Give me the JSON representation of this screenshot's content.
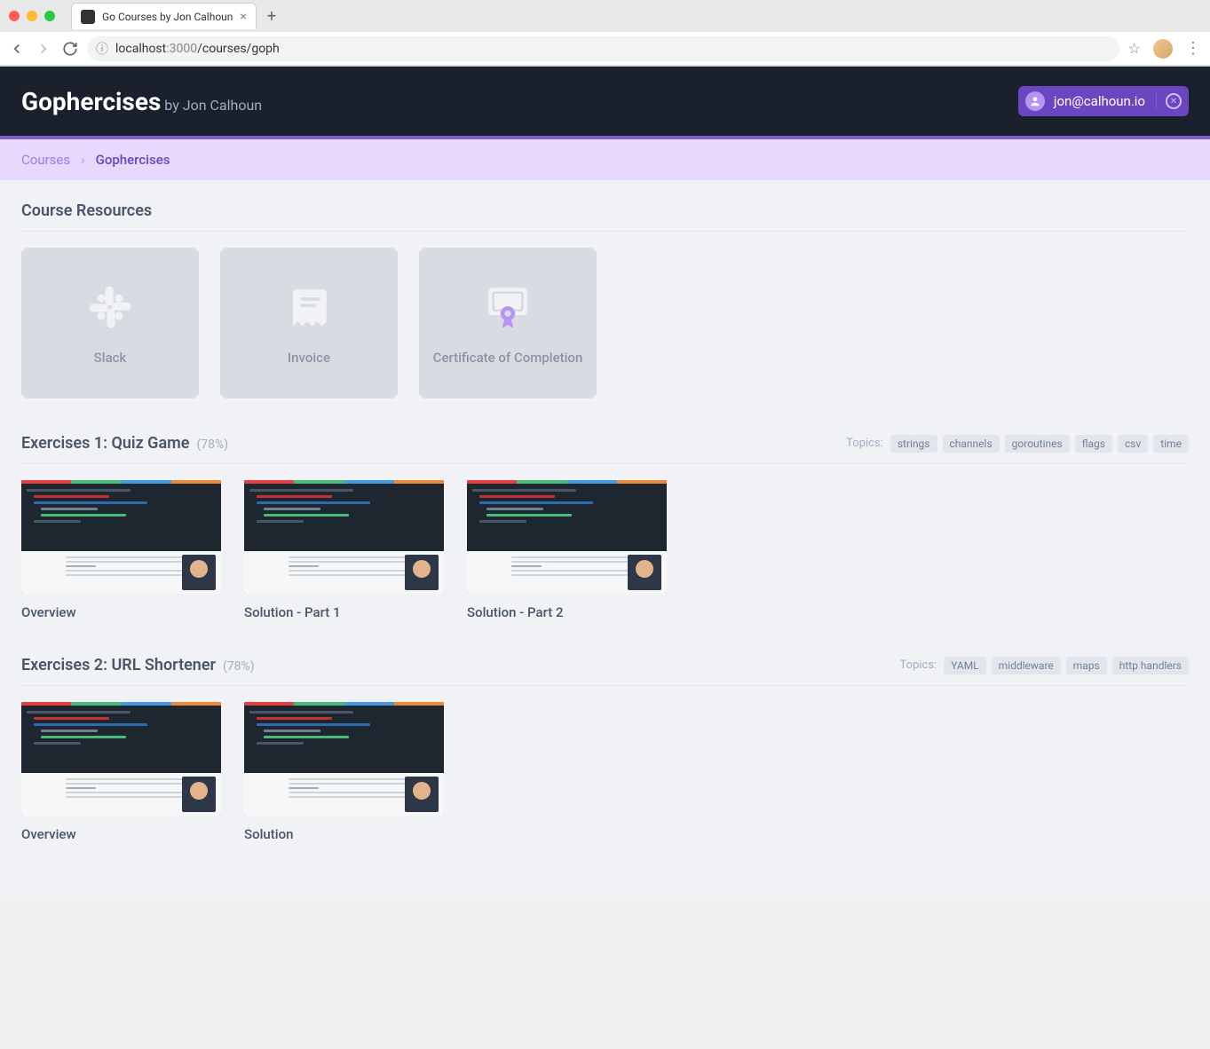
{
  "browser": {
    "tab_title": "Go Courses by Jon Calhoun",
    "url_host": "localhost",
    "url_port": ":3000",
    "url_path": "/courses/goph"
  },
  "header": {
    "title": "Gophercises",
    "subtitle": "by Jon Calhoun",
    "user_email": "jon@calhoun.io"
  },
  "breadcrumbs": {
    "a": "Courses",
    "b": "Gophercises"
  },
  "resources": {
    "heading": "Course Resources",
    "items": [
      {
        "label": "Slack"
      },
      {
        "label": "Invoice"
      },
      {
        "label": "Certificate of Completion"
      }
    ]
  },
  "exercises": [
    {
      "title": "Exercises 1: Quiz Game",
      "pct": "(78%)",
      "topics_label": "Topics:",
      "topics": [
        "strings",
        "channels",
        "goroutines",
        "flags",
        "csv",
        "time"
      ],
      "videos": [
        {
          "title": "Overview"
        },
        {
          "title": "Solution - Part 1"
        },
        {
          "title": "Solution - Part 2"
        }
      ]
    },
    {
      "title": "Exercises 2: URL Shortener",
      "pct": "(78%)",
      "topics_label": "Topics:",
      "topics": [
        "YAML",
        "middleware",
        "maps",
        "http handlers"
      ],
      "videos": [
        {
          "title": "Overview"
        },
        {
          "title": "Solution"
        }
      ]
    }
  ]
}
